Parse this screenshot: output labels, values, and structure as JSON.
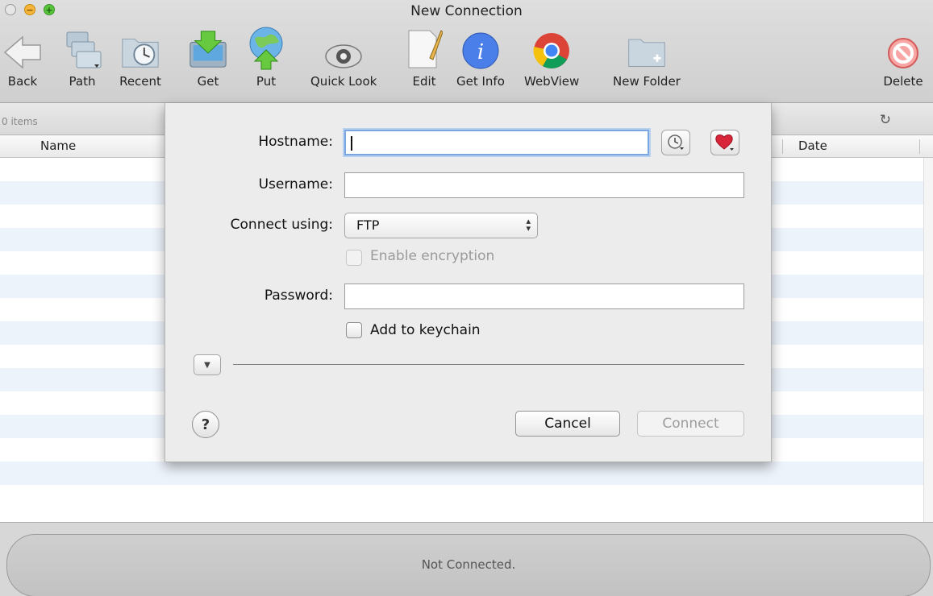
{
  "window": {
    "title": "New Connection"
  },
  "toolbar": {
    "items": [
      {
        "label": "Back",
        "icon": "back-arrow-icon"
      },
      {
        "label": "Path",
        "icon": "path-folders-icon"
      },
      {
        "label": "Recent",
        "icon": "recent-folder-icon"
      },
      {
        "label": "Get",
        "icon": "get-download-icon"
      },
      {
        "label": "Put",
        "icon": "put-upload-icon"
      },
      {
        "label": "Quick Look",
        "icon": "eye-icon"
      },
      {
        "label": "Edit",
        "icon": "edit-pencil-icon"
      },
      {
        "label": "Get Info",
        "icon": "info-icon"
      },
      {
        "label": "WebView",
        "icon": "chrome-icon"
      },
      {
        "label": "New Folder",
        "icon": "new-folder-icon"
      },
      {
        "label": "Delete",
        "icon": "delete-icon"
      }
    ]
  },
  "list": {
    "items_count": "0 items",
    "columns": {
      "name": "Name",
      "date": "Date"
    }
  },
  "dialog": {
    "hostname_label": "Hostname:",
    "hostname_value": "",
    "username_label": "Username:",
    "username_value": "",
    "connect_using_label": "Connect using:",
    "connect_using_value": "FTP",
    "encryption_label": "Enable encryption",
    "encryption_checked": false,
    "password_label": "Password:",
    "password_value": "",
    "keychain_label": "Add to keychain",
    "keychain_checked": false,
    "cancel_label": "Cancel",
    "connect_label": "Connect",
    "help_label": "?"
  },
  "status": {
    "text": "Not Connected."
  },
  "colors": {
    "focus_ring": "#7aa7e0",
    "row_stripe": "#edf3fb",
    "heart": "#d9253a",
    "info_blue": "#4a7ee8"
  }
}
